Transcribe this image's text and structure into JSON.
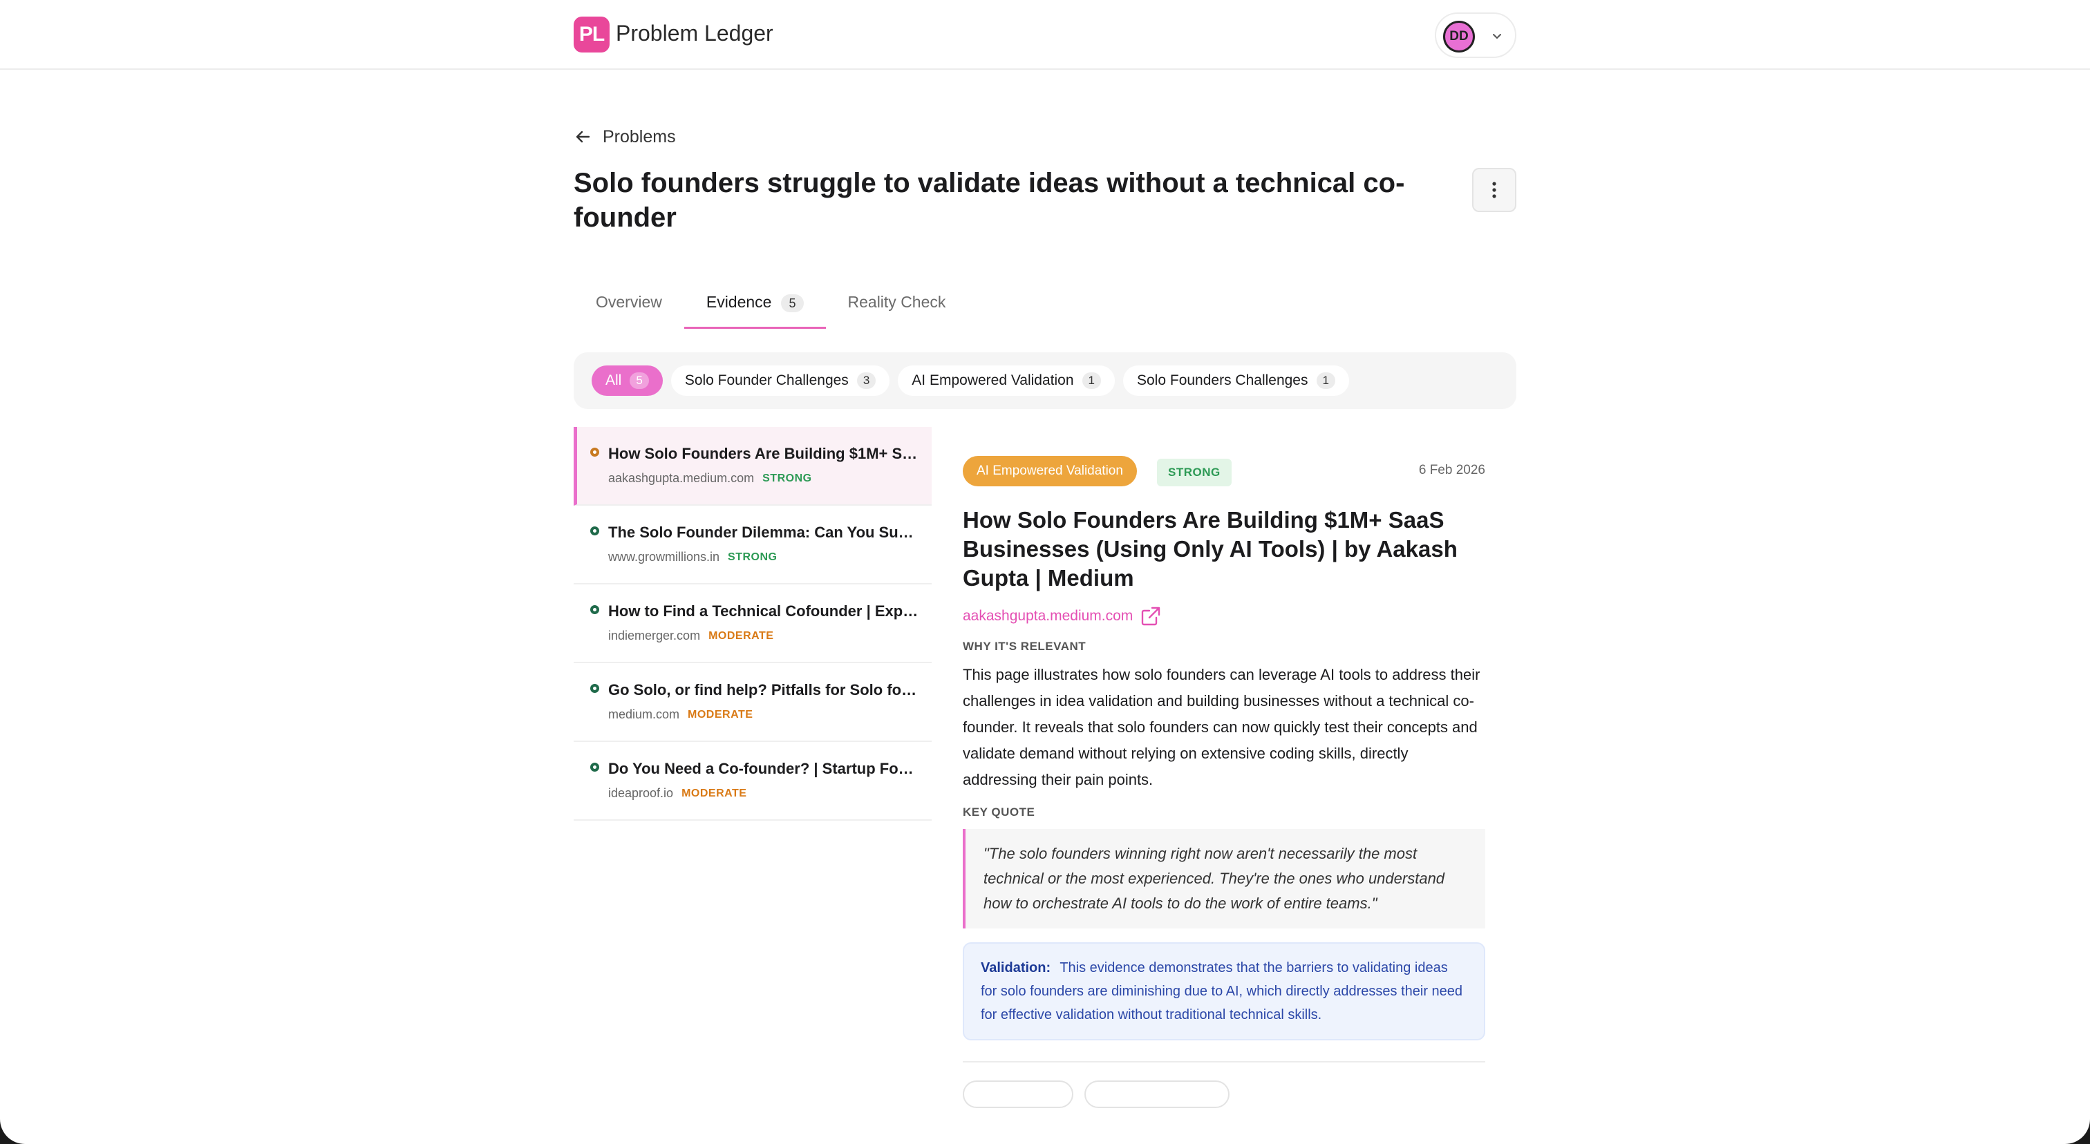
{
  "app": {
    "logo_mark": "PL",
    "name": "Problem Ledger"
  },
  "user": {
    "initials": "DD"
  },
  "nav": {
    "back_label": "Problems"
  },
  "problem": {
    "title": "Solo founders struggle to validate ideas without a technical co-founder"
  },
  "tabs": [
    {
      "label": "Overview",
      "count": ""
    },
    {
      "label": "Evidence",
      "count": "5"
    },
    {
      "label": "Reality Check",
      "count": ""
    }
  ],
  "filters": [
    {
      "label": "All",
      "count": "5"
    },
    {
      "label": "Solo Founder Challenges",
      "count": "3"
    },
    {
      "label": "AI Empowered Validation",
      "count": "1"
    },
    {
      "label": "Solo Founders Challenges",
      "count": "1"
    }
  ],
  "evidence": [
    {
      "title": "How Solo Founders Are Building $1M+ SaaS Businesses (Using Only AI Tools) | by Aakash Gupta | Medium",
      "source": "aakashgupta.medium.com",
      "strength": "STRONG"
    },
    {
      "title": "The Solo Founder Dilemma: Can You Succeed Without a Co-founder?",
      "source": "www.growmillions.in",
      "strength": "STRONG"
    },
    {
      "title": "How to Find a Technical Cofounder | Expert Guide",
      "source": "indiemerger.com",
      "strength": "MODERATE"
    },
    {
      "title": "Go Solo, or find help? Pitfalls for Solo founders",
      "source": "medium.com",
      "strength": "MODERATE"
    },
    {
      "title": "Do You Need a Co-founder? | Startup Founders Guide",
      "source": "ideaproof.io",
      "strength": "MODERATE"
    }
  ],
  "detail": {
    "category": "AI Empowered Validation",
    "strength": "STRONG",
    "date": "6 Feb 2026",
    "title": "How Solo Founders Are Building $1M+ SaaS Businesses (Using Only AI Tools) | by Aakash Gupta | Medium",
    "source": "aakashgupta.medium.com",
    "why_label": "WHY IT'S RELEVANT",
    "why_text": "This page illustrates how solo founders can leverage AI tools to address their challenges in idea validation and building businesses without a technical co-founder. It reveals that solo founders can now quickly test their concepts and validate demand without relying on extensive coding skills, directly addressing their pain points.",
    "quote_label": "KEY QUOTE",
    "quote": "\"The solo founders winning right now aren't necessarily the most technical or the most experienced. They're the ones who understand how to orchestrate AI tools to do the work of entire teams.\"",
    "validation_label": "Validation:",
    "validation_text": "This evidence demonstrates that the barriers to validating ideas for solo founders are diminishing due to AI, which directly addresses their need for effective validation without traditional technical skills."
  },
  "colors": {
    "accent": "#ea6fcb",
    "brand": "#e9479a",
    "strong": "#2d9a55",
    "moderate": "#d97a16",
    "category": "#eda53c"
  }
}
